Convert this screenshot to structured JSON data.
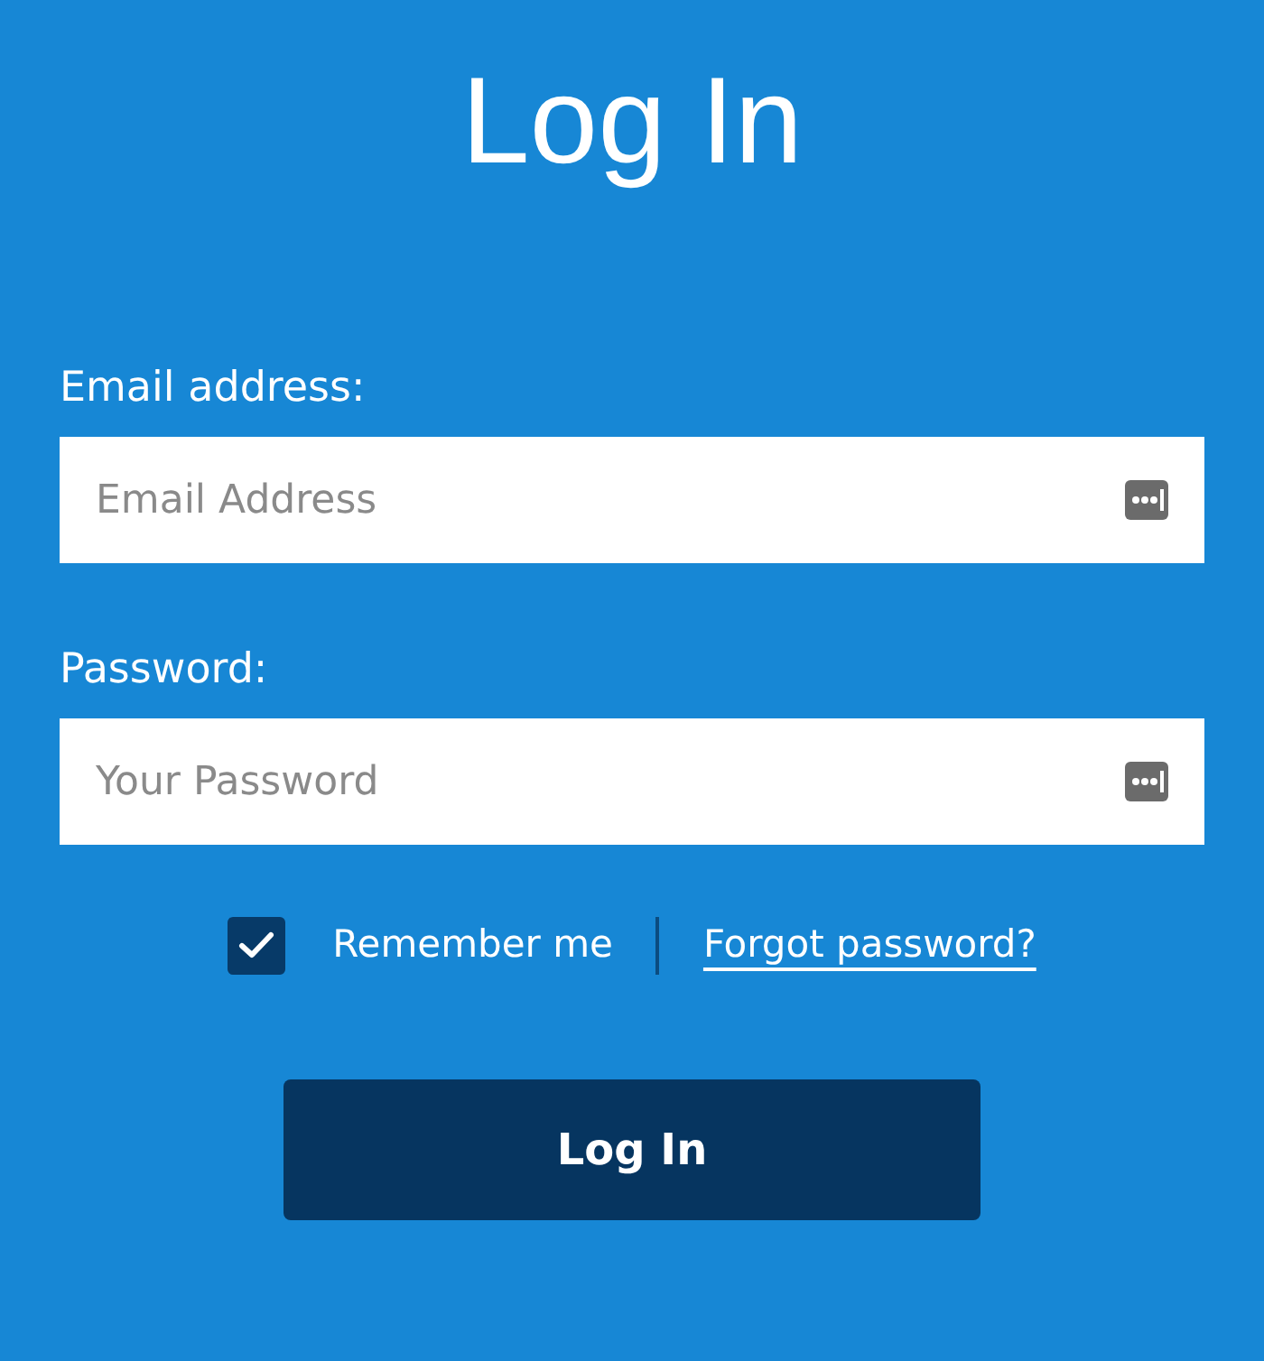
{
  "title": "Log In",
  "fields": [
    {
      "label": "Email address:",
      "placeholder": "Email Address"
    },
    {
      "label": "Password:",
      "placeholder": "Your Password"
    }
  ],
  "remember": {
    "label": "Remember me",
    "checked": true
  },
  "forgot_link": "Forgot password?",
  "submit": "Log In"
}
